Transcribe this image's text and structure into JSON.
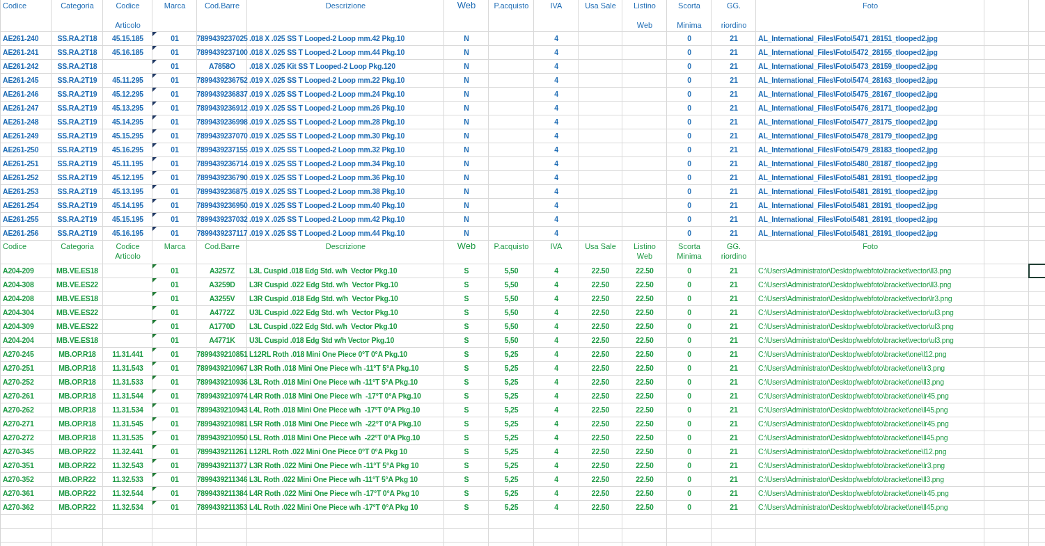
{
  "sections": [
    {
      "color": "#1f6db5",
      "header": [
        [
          "Codice"
        ],
        [
          "Categoria"
        ],
        [
          "Codice",
          "Articolo"
        ],
        [
          "Marca"
        ],
        [
          "Cod.Barre"
        ],
        [
          "Descrizione"
        ],
        [
          "Web"
        ],
        [
          "P.acquisto"
        ],
        [
          "IVA"
        ],
        [
          "Usa Sale"
        ],
        [
          "Listino",
          "Web"
        ],
        [
          "Scorta",
          "Minima"
        ],
        [
          "GG.",
          "riordino"
        ],
        [
          "Foto"
        ]
      ],
      "rows": [
        {
          "codice": "AE261-240",
          "categoria": "SS.RA.2T18",
          "codice_articolo": "45.15.185",
          "marca": "01",
          "cod_barre": "7899439237025",
          "descrizione": ".018 X .025 SS T Looped-2 Loop mm.42 Pkg.10",
          "web": "N",
          "iva": "4",
          "scorta_minima": "0",
          "gg_riordino": "21",
          "foto": "AL_International_Files\\Foto\\5471_28151_tlooped2.jpg",
          "warning": true,
          "selected": false
        },
        {
          "codice": "AE261-241",
          "categoria": "SS.RA.2T18",
          "codice_articolo": "45.16.185",
          "marca": "01",
          "cod_barre": "7899439237100",
          "descrizione": ".018 X .025 SS T Looped-2 Loop mm.44 Pkg.10",
          "web": "N",
          "iva": "4",
          "scorta_minima": "0",
          "gg_riordino": "21",
          "foto": "AL_International_Files\\Foto\\5472_28155_tlooped2.jpg",
          "warning": true,
          "selected": false
        },
        {
          "codice": "AE261-242",
          "categoria": "SS.RA.2T18",
          "marca": "01",
          "cod_barre": "A7858O",
          "descrizione": ".018 X .025 Kit SS T Looped-2 Loop Pkg.120",
          "web": "N",
          "iva": "4",
          "scorta_minima": "0",
          "gg_riordino": "21",
          "foto": "AL_International_Files\\Foto\\5473_28159_tlooped2.jpg",
          "warning": true,
          "selected": false
        },
        {
          "codice": "AE261-245",
          "categoria": "SS.RA.2T19",
          "codice_articolo": "45.11.295",
          "marca": "01",
          "cod_barre": "7899439236752",
          "descrizione": ".019 X .025 SS T Looped-2 Loop mm.22 Pkg.10",
          "web": "N",
          "iva": "4",
          "scorta_minima": "0",
          "gg_riordino": "21",
          "foto": "AL_International_Files\\Foto\\5474_28163_tlooped2.jpg",
          "warning": true,
          "selected": false
        },
        {
          "codice": "AE261-246",
          "categoria": "SS.RA.2T19",
          "codice_articolo": "45.12.295",
          "marca": "01",
          "cod_barre": "7899439236837",
          "descrizione": ".019 X .025 SS T Looped-2 Loop mm.24 Pkg.10",
          "web": "N",
          "iva": "4",
          "scorta_minima": "0",
          "gg_riordino": "21",
          "foto": "AL_International_Files\\Foto\\5475_28167_tlooped2.jpg",
          "warning": true,
          "selected": false
        },
        {
          "codice": "AE261-247",
          "categoria": "SS.RA.2T19",
          "codice_articolo": "45.13.295",
          "marca": "01",
          "cod_barre": "7899439236912",
          "descrizione": ".019 X .025 SS T Looped-2 Loop mm.26 Pkg.10",
          "web": "N",
          "iva": "4",
          "scorta_minima": "0",
          "gg_riordino": "21",
          "foto": "AL_International_Files\\Foto\\5476_28171_tlooped2.jpg",
          "warning": true,
          "selected": false
        },
        {
          "codice": "AE261-248",
          "categoria": "SS.RA.2T19",
          "codice_articolo": "45.14.295",
          "marca": "01",
          "cod_barre": "7899439236998",
          "descrizione": ".019 X .025 SS T Looped-2 Loop mm.28 Pkg.10",
          "web": "N",
          "iva": "4",
          "scorta_minima": "0",
          "gg_riordino": "21",
          "foto": "AL_International_Files\\Foto\\5477_28175_tlooped2.jpg",
          "warning": true,
          "selected": false
        },
        {
          "codice": "AE261-249",
          "categoria": "SS.RA.2T19",
          "codice_articolo": "45.15.295",
          "marca": "01",
          "cod_barre": "7899439237070",
          "descrizione": ".019 X .025 SS T Looped-2 Loop mm.30 Pkg.10",
          "web": "N",
          "iva": "4",
          "scorta_minima": "0",
          "gg_riordino": "21",
          "foto": "AL_International_Files\\Foto\\5478_28179_tlooped2.jpg",
          "warning": true,
          "selected": false
        },
        {
          "codice": "AE261-250",
          "categoria": "SS.RA.2T19",
          "codice_articolo": "45.16.295",
          "marca": "01",
          "cod_barre": "7899439237155",
          "descrizione": ".019 X .025 SS T Looped-2 Loop mm.32 Pkg.10",
          "web": "N",
          "iva": "4",
          "scorta_minima": "0",
          "gg_riordino": "21",
          "foto": "AL_International_Files\\Foto\\5479_28183_tlooped2.jpg",
          "warning": true,
          "selected": false
        },
        {
          "codice": "AE261-251",
          "categoria": "SS.RA.2T19",
          "codice_articolo": "45.11.195",
          "marca": "01",
          "cod_barre": "7899439236714",
          "descrizione": ".019 X .025 SS T Looped-2 Loop mm.34 Pkg.10",
          "web": "N",
          "iva": "4",
          "scorta_minima": "0",
          "gg_riordino": "21",
          "foto": "AL_International_Files\\Foto\\5480_28187_tlooped2.jpg",
          "warning": true,
          "selected": false
        },
        {
          "codice": "AE261-252",
          "categoria": "SS.RA.2T19",
          "codice_articolo": "45.12.195",
          "marca": "01",
          "cod_barre": "7899439236790",
          "descrizione": ".019 X .025 SS T Looped-2 Loop mm.36 Pkg.10",
          "web": "N",
          "iva": "4",
          "scorta_minima": "0",
          "gg_riordino": "21",
          "foto": "AL_International_Files\\Foto\\5481_28191_tlooped2.jpg",
          "warning": true,
          "selected": false
        },
        {
          "codice": "AE261-253",
          "categoria": "SS.RA.2T19",
          "codice_articolo": "45.13.195",
          "marca": "01",
          "cod_barre": "7899439236875",
          "descrizione": ".019 X .025 SS T Looped-2 Loop mm.38 Pkg.10",
          "web": "N",
          "iva": "4",
          "scorta_minima": "0",
          "gg_riordino": "21",
          "foto": "AL_International_Files\\Foto\\5481_28191_tlooped2.jpg",
          "warning": true,
          "selected": false
        },
        {
          "codice": "AE261-254",
          "categoria": "SS.RA.2T19",
          "codice_articolo": "45.14.195",
          "marca": "01",
          "cod_barre": "7899439236950",
          "descrizione": ".019 X .025 SS T Looped-2 Loop mm.40 Pkg.10",
          "web": "N",
          "iva": "4",
          "scorta_minima": "0",
          "gg_riordino": "21",
          "foto": "AL_International_Files\\Foto\\5481_28191_tlooped2.jpg",
          "warning": true,
          "selected": false
        },
        {
          "codice": "AE261-255",
          "categoria": "SS.RA.2T19",
          "codice_articolo": "45.15.195",
          "marca": "01",
          "cod_barre": "7899439237032",
          "descrizione": ".019 X .025 SS T Looped-2 Loop mm.42 Pkg.10",
          "web": "N",
          "iva": "4",
          "scorta_minima": "0",
          "gg_riordino": "21",
          "foto": "AL_International_Files\\Foto\\5481_28191_tlooped2.jpg",
          "warning": true,
          "selected": false
        },
        {
          "codice": "AE261-256",
          "categoria": "SS.RA.2T19",
          "codice_articolo": "45.16.195",
          "marca": "01",
          "cod_barre": "7899439237117",
          "descrizione": ".019 X .025 SS T Looped-2 Loop mm.44 Pkg.10",
          "web": "N",
          "iva": "4",
          "scorta_minima": "0",
          "gg_riordino": "21",
          "foto": "AL_International_Files\\Foto\\5481_28191_tlooped2.jpg",
          "warning": true,
          "selected": false
        }
      ]
    },
    {
      "color": "#1e9a45",
      "header": [
        [
          "Codice"
        ],
        [
          "Categoria"
        ],
        [
          "Codice",
          "Articolo"
        ],
        [
          "Marca"
        ],
        [
          "Cod.Barre"
        ],
        [
          "Descrizione"
        ],
        [
          "Web"
        ],
        [
          "P.acquisto"
        ],
        [
          "IVA"
        ],
        [
          "Usa Sale"
        ],
        [
          "Listino",
          "Web"
        ],
        [
          "Scorta",
          "Minima"
        ],
        [
          "GG.",
          "riordino"
        ],
        [
          "Foto"
        ]
      ],
      "rows": [
        {
          "codice": "A204-209",
          "categoria": "MB.VE.ES18",
          "marca": "01",
          "cod_barre": "A3257Z",
          "descrizione": "L3L Cuspid .018 Edg Std. w/h  Vector Pkg.10",
          "web": "S",
          "p_acquisto": "5,50",
          "iva": "4",
          "usa_sale": "22.50",
          "listino_web": "22.50",
          "scorta_minima": "0",
          "gg_riordino": "21",
          "foto": "C:\\Users\\Administrator\\Desktop\\webfoto\\bracket\\vector\\ll3.png",
          "warning": true,
          "selected": true
        },
        {
          "codice": "A204-308",
          "categoria": "MB.VE.ES22",
          "marca": "01",
          "cod_barre": "A3259D",
          "descrizione": "L3R Cuspid .022 Edg Std. w/h  Vector Pkg.10",
          "web": "S",
          "p_acquisto": "5,50",
          "iva": "4",
          "usa_sale": "22.50",
          "listino_web": "22.50",
          "scorta_minima": "0",
          "gg_riordino": "21",
          "foto": "C:\\Users\\Administrator\\Desktop\\webfoto\\bracket\\vector\\ll3.png",
          "warning": true,
          "selected": false
        },
        {
          "codice": "A204-208",
          "categoria": "MB.VE.ES18",
          "marca": "01",
          "cod_barre": "A3255V",
          "descrizione": "L3R Cuspid .018 Edg Std. w/h  Vector Pkg.10",
          "web": "S",
          "p_acquisto": "5,50",
          "iva": "4",
          "usa_sale": "22.50",
          "listino_web": "22.50",
          "scorta_minima": "0",
          "gg_riordino": "21",
          "foto": "C:\\Users\\Administrator\\Desktop\\webfoto\\bracket\\vector\\lr3.png",
          "warning": true,
          "selected": false
        },
        {
          "codice": "A204-304",
          "categoria": "MB.VE.ES22",
          "marca": "01",
          "cod_barre": "A4772Z",
          "descrizione": "U3L Cuspid .022 Edg Std. w/h  Vector Pkg.10",
          "web": "S",
          "p_acquisto": "5,50",
          "iva": "4",
          "usa_sale": "22.50",
          "listino_web": "22.50",
          "scorta_minima": "0",
          "gg_riordino": "21",
          "foto": "C:\\Users\\Administrator\\Desktop\\webfoto\\bracket\\vector\\ul3.png",
          "warning": true,
          "selected": false
        },
        {
          "codice": "A204-309",
          "categoria": "MB.VE.ES22",
          "marca": "01",
          "cod_barre": "A1770D",
          "descrizione": "L3L Cuspid .022 Edg Std. w/h  Vector Pkg.10",
          "web": "S",
          "p_acquisto": "5,50",
          "iva": "4",
          "usa_sale": "22.50",
          "listino_web": "22.50",
          "scorta_minima": "0",
          "gg_riordino": "21",
          "foto": "C:\\Users\\Administrator\\Desktop\\webfoto\\bracket\\vector\\ul3.png",
          "warning": true,
          "selected": false
        },
        {
          "codice": "A204-204",
          "categoria": "MB.VE.ES18",
          "marca": "01",
          "cod_barre": "A4771K",
          "descrizione": "U3L Cuspid .018 Edg Std w/h Vector Pkg.10",
          "web": "S",
          "p_acquisto": "5,50",
          "iva": "4",
          "usa_sale": "22.50",
          "listino_web": "22.50",
          "scorta_minima": "0",
          "gg_riordino": "21",
          "foto": "C:\\Users\\Administrator\\Desktop\\webfoto\\bracket\\vector\\ul3.png",
          "warning": true,
          "selected": false
        },
        {
          "codice": "A270-245",
          "categoria": "MB.OP.R18",
          "codice_articolo": "11.31.441",
          "marca": "01",
          "cod_barre": "7899439210851",
          "descrizione": "L12RL Roth .018 Mini One Piece 0°T 0°A Pkg.10",
          "web": "S",
          "p_acquisto": "5,25",
          "iva": "4",
          "usa_sale": "22.50",
          "listino_web": "22.50",
          "scorta_minima": "0",
          "gg_riordino": "21",
          "foto": "C:\\Users\\Administrator\\Desktop\\webfoto\\bracket\\one\\l12.png",
          "warning": true,
          "selected": false
        },
        {
          "codice": "A270-251",
          "categoria": "MB.OP.R18",
          "codice_articolo": "11.31.543",
          "marca": "01",
          "cod_barre": "7899439210967",
          "descrizione": "L3R Roth .018 Mini One Piece w/h -11°T 5°A Pkg.10",
          "web": "S",
          "p_acquisto": "5,25",
          "iva": "4",
          "usa_sale": "22.50",
          "listino_web": "22.50",
          "scorta_minima": "0",
          "gg_riordino": "21",
          "foto": "C:\\Users\\Administrator\\Desktop\\webfoto\\bracket\\one\\lr3.png",
          "warning": true,
          "selected": false
        },
        {
          "codice": "A270-252",
          "categoria": "MB.OP.R18",
          "codice_articolo": "11.31.533",
          "marca": "01",
          "cod_barre": "7899439210936",
          "descrizione": "L3L Roth .018 Mini One Piece w/h -11°T 5°A Pkg.10",
          "web": "S",
          "p_acquisto": "5,25",
          "iva": "4",
          "usa_sale": "22.50",
          "listino_web": "22.50",
          "scorta_minima": "0",
          "gg_riordino": "21",
          "foto": "C:\\Users\\Administrator\\Desktop\\webfoto\\bracket\\one\\ll3.png",
          "warning": true,
          "selected": false
        },
        {
          "codice": "A270-261",
          "categoria": "MB.OP.R18",
          "codice_articolo": "11.31.544",
          "marca": "01",
          "cod_barre": "7899439210974",
          "descrizione": "L4R Roth .018 Mini One Piece w/h  -17°T 0°A Pkg.10",
          "web": "S",
          "p_acquisto": "5,25",
          "iva": "4",
          "usa_sale": "22.50",
          "listino_web": "22.50",
          "scorta_minima": "0",
          "gg_riordino": "21",
          "foto": "C:\\Users\\Administrator\\Desktop\\webfoto\\bracket\\one\\lr45.png",
          "warning": true,
          "selected": false
        },
        {
          "codice": "A270-262",
          "categoria": "MB.OP.R18",
          "codice_articolo": "11.31.534",
          "marca": "01",
          "cod_barre": "7899439210943",
          "descrizione": "L4L Roth .018 Mini One Piece w/h  -17°T 0°A Pkg.10",
          "web": "S",
          "p_acquisto": "5,25",
          "iva": "4",
          "usa_sale": "22.50",
          "listino_web": "22.50",
          "scorta_minima": "0",
          "gg_riordino": "21",
          "foto": "C:\\Users\\Administrator\\Desktop\\webfoto\\bracket\\one\\ll45.png",
          "warning": true,
          "selected": false
        },
        {
          "codice": "A270-271",
          "categoria": "MB.OP.R18",
          "codice_articolo": "11.31.545",
          "marca": "01",
          "cod_barre": "7899439210981",
          "descrizione": "L5R Roth .018 Mini One Piece w/h  -22°T 0°A Pkg.10",
          "web": "S",
          "p_acquisto": "5,25",
          "iva": "4",
          "usa_sale": "22.50",
          "listino_web": "22.50",
          "scorta_minima": "0",
          "gg_riordino": "21",
          "foto": "C:\\Users\\Administrator\\Desktop\\webfoto\\bracket\\one\\lr45.png",
          "warning": true,
          "selected": false
        },
        {
          "codice": "A270-272",
          "categoria": "MB.OP.R18",
          "codice_articolo": "11.31.535",
          "marca": "01",
          "cod_barre": "7899439210950",
          "descrizione": "L5L Roth .018 Mini One Piece w/h  -22°T 0°A Pkg.10",
          "web": "S",
          "p_acquisto": "5,25",
          "iva": "4",
          "usa_sale": "22.50",
          "listino_web": "22.50",
          "scorta_minima": "0",
          "gg_riordino": "21",
          "foto": "C:\\Users\\Administrator\\Desktop\\webfoto\\bracket\\one\\ll45.png",
          "warning": true,
          "selected": false
        },
        {
          "codice": "A270-345",
          "categoria": "MB.OP.R22",
          "codice_articolo": "11.32.441",
          "marca": "01",
          "cod_barre": "7899439211261",
          "descrizione": "L12RL Roth .022 Mini One Piece 0°T 0°A Pkg 10",
          "web": "S",
          "p_acquisto": "5,25",
          "iva": "4",
          "usa_sale": "22.50",
          "listino_web": "22.50",
          "scorta_minima": "0",
          "gg_riordino": "21",
          "foto": "C:\\Users\\Administrator\\Desktop\\webfoto\\bracket\\one\\l12.png",
          "warning": true,
          "selected": false
        },
        {
          "codice": "A270-351",
          "categoria": "MB.OP.R22",
          "codice_articolo": "11.32.543",
          "marca": "01",
          "cod_barre": "7899439211377",
          "descrizione": "L3R Roth .022 Mini One Piece w/h -11°T 5°A Pkg 10",
          "web": "S",
          "p_acquisto": "5,25",
          "iva": "4",
          "usa_sale": "22.50",
          "listino_web": "22.50",
          "scorta_minima": "0",
          "gg_riordino": "21",
          "foto": "C:\\Users\\Administrator\\Desktop\\webfoto\\bracket\\one\\lr3.png",
          "warning": true,
          "selected": false
        },
        {
          "codice": "A270-352",
          "categoria": "MB.OP.R22",
          "codice_articolo": "11.32.533",
          "marca": "01",
          "cod_barre": "7899439211346",
          "descrizione": "L3L Roth .022 Mini One Piece w/h -11°T 5°A Pkg 10",
          "web": "S",
          "p_acquisto": "5,25",
          "iva": "4",
          "usa_sale": "22.50",
          "listino_web": "22.50",
          "scorta_minima": "0",
          "gg_riordino": "21",
          "foto": "C:\\Users\\Administrator\\Desktop\\webfoto\\bracket\\one\\ll3.png",
          "warning": true,
          "selected": false
        },
        {
          "codice": "A270-361",
          "categoria": "MB.OP.R22",
          "codice_articolo": "11.32.544",
          "marca": "01",
          "cod_barre": "7899439211384",
          "descrizione": "L4R Roth .022 Mini One Piece w/h -17°T 0°A Pkg 10",
          "web": "S",
          "p_acquisto": "5,25",
          "iva": "4",
          "usa_sale": "22.50",
          "listino_web": "22.50",
          "scorta_minima": "0",
          "gg_riordino": "21",
          "foto": "C:\\Users\\Administrator\\Desktop\\webfoto\\bracket\\one\\lr45.png",
          "warning": true,
          "selected": false
        },
        {
          "codice": "A270-362",
          "categoria": "MB.OP.R22",
          "codice_articolo": "11.32.534",
          "marca": "01",
          "cod_barre": "7899439211353",
          "descrizione": "L4L Roth .022 Mini One Piece w/h -17°T 0°A Pkg 10",
          "web": "S",
          "p_acquisto": "5,25",
          "iva": "4",
          "usa_sale": "22.50",
          "listino_web": "22.50",
          "scorta_minima": "0",
          "gg_riordino": "21",
          "foto": "C:\\Users\\Administrator\\Desktop\\webfoto\\bracket\\one\\ll45.png",
          "warning": true,
          "selected": false
        }
      ]
    }
  ]
}
